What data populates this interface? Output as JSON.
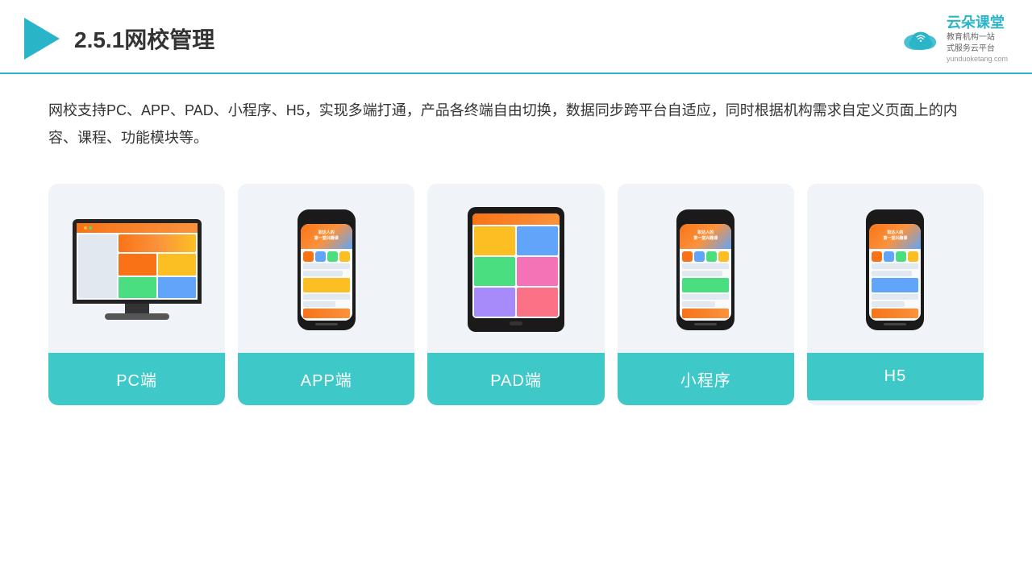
{
  "header": {
    "title": "2.5.1网校管理",
    "brand": {
      "name": "云朵课堂",
      "sub_line1": "教育机构一站",
      "sub_line2": "式服务云平台",
      "url": "yunduoketang.com"
    }
  },
  "description": {
    "text": "网校支持PC、APP、PAD、小程序、H5，实现多端打通，产品各终端自由切换，数据同步跨平台自适应，同时根据机构需求自定义页面上的内容、课程、功能模块等。"
  },
  "cards": [
    {
      "id": "pc",
      "label": "PC端"
    },
    {
      "id": "app",
      "label": "APP端"
    },
    {
      "id": "pad",
      "label": "PAD端"
    },
    {
      "id": "miniprogram",
      "label": "小程序"
    },
    {
      "id": "h5",
      "label": "H5"
    }
  ],
  "colors": {
    "accent": "#2bb5c8",
    "card_label_bg": "#3ec8c8",
    "card_bg": "#edf2f7"
  }
}
